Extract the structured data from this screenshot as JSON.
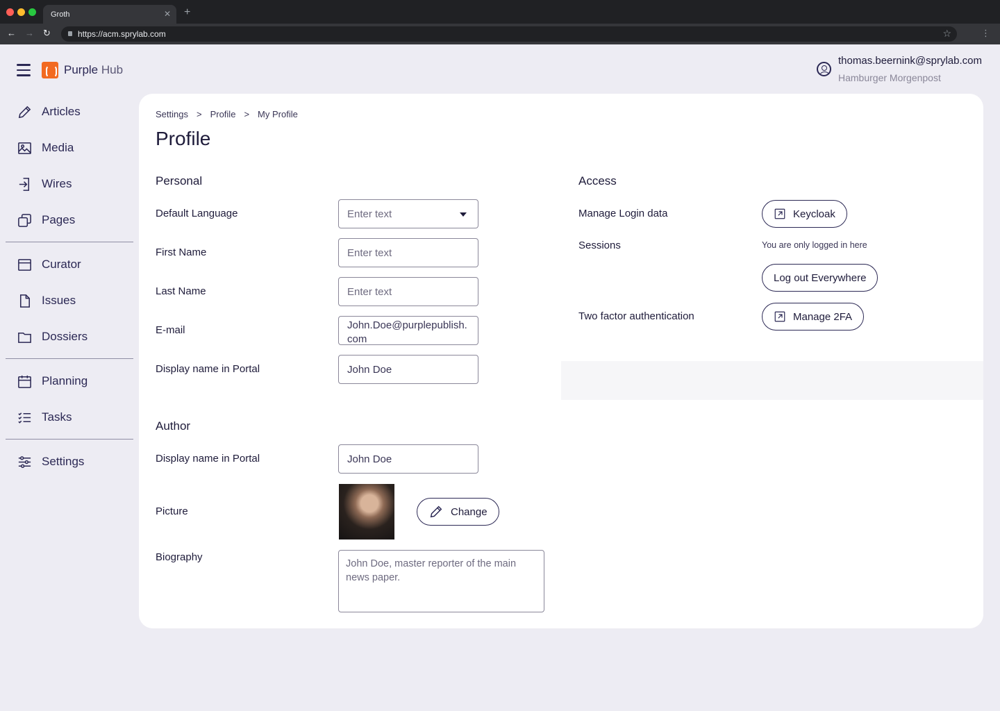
{
  "browser": {
    "tab_title": "Groth",
    "url": "https://acm.sprylab.com"
  },
  "header": {
    "brand_main": "Purple",
    "brand_sub": "Hub",
    "user_email": "thomas.beernink@sprylab.com",
    "user_org": "Hamburger Morgenpost"
  },
  "sidebar": {
    "items": [
      {
        "label": "Articles",
        "icon": "pencil-icon"
      },
      {
        "label": "Media",
        "icon": "image-icon"
      },
      {
        "label": "Wires",
        "icon": "import-icon"
      },
      {
        "label": "Pages",
        "icon": "pages-icon"
      },
      {
        "label": "Curator",
        "icon": "browser-window-icon"
      },
      {
        "label": "Issues",
        "icon": "document-icon"
      },
      {
        "label": "Dossiers",
        "icon": "folder-icon"
      },
      {
        "label": "Planning",
        "icon": "calendar-icon"
      },
      {
        "label": "Tasks",
        "icon": "task-list-icon"
      },
      {
        "label": "Settings",
        "icon": "sliders-icon"
      }
    ]
  },
  "breadcrumb": [
    "Settings",
    "Profile",
    "My Profile"
  ],
  "breadcrumb_sep": ">",
  "page_title": "Profile",
  "personal": {
    "title": "Personal",
    "default_language_label": "Default Language",
    "default_language_placeholder": "Enter text",
    "first_name_label": "First Name",
    "first_name_placeholder": "Enter text",
    "last_name_label": "Last Name",
    "last_name_placeholder": "Enter text",
    "email_label": "E-mail",
    "email_value_line1": "John.Doe@purplepublish.",
    "email_value_line2": "com",
    "display_name_label": "Display name in Portal",
    "display_name_value": "John Doe"
  },
  "author": {
    "title": "Author",
    "display_name_label": "Display name in Portal",
    "display_name_value": "John Doe",
    "picture_label": "Picture",
    "change_button": "Change",
    "biography_label": "Biography",
    "biography_value": "John Doe, master reporter of the  main news paper."
  },
  "access": {
    "title": "Access",
    "manage_login_label": "Manage Login data",
    "keycloak_button": "Keycloak",
    "sessions_label": "Sessions",
    "sessions_note": "You are only logged in here",
    "logout_button": "Log out Everywhere",
    "twofa_label": "Two factor authentication",
    "twofa_button": "Manage 2FA"
  },
  "colors": {
    "accent": "#2b2854",
    "brand_orange": "#f26a21",
    "background": "#edecf3"
  }
}
